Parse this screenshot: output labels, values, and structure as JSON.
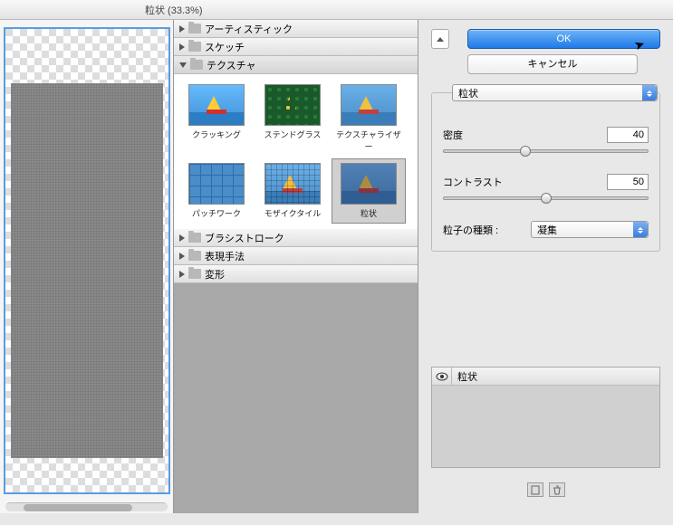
{
  "title": "粒状 (33.3%)",
  "categories": [
    {
      "label": "アーティスティック",
      "open": false
    },
    {
      "label": "スケッチ",
      "open": false
    },
    {
      "label": "テクスチャ",
      "open": true
    },
    {
      "label": "ブラシストローク",
      "open": false
    },
    {
      "label": "表現手法",
      "open": false
    },
    {
      "label": "変形",
      "open": false
    }
  ],
  "thumbs": [
    {
      "label": "クラッキング"
    },
    {
      "label": "ステンドグラス"
    },
    {
      "label": "テクスチャライザー"
    },
    {
      "label": "パッチワーク"
    },
    {
      "label": "モザイクタイル"
    },
    {
      "label": "粒状",
      "selected": true
    }
  ],
  "buttons": {
    "ok": "OK",
    "cancel": "キャンセル"
  },
  "filter_select": "粒状",
  "params": {
    "density": {
      "label": "密度",
      "value": "40",
      "pos": 40
    },
    "contrast": {
      "label": "コントラスト",
      "value": "50",
      "pos": 50
    },
    "type": {
      "label": "粒子の種類 :",
      "value": "凝集"
    }
  },
  "applied": {
    "label": "粒状"
  }
}
